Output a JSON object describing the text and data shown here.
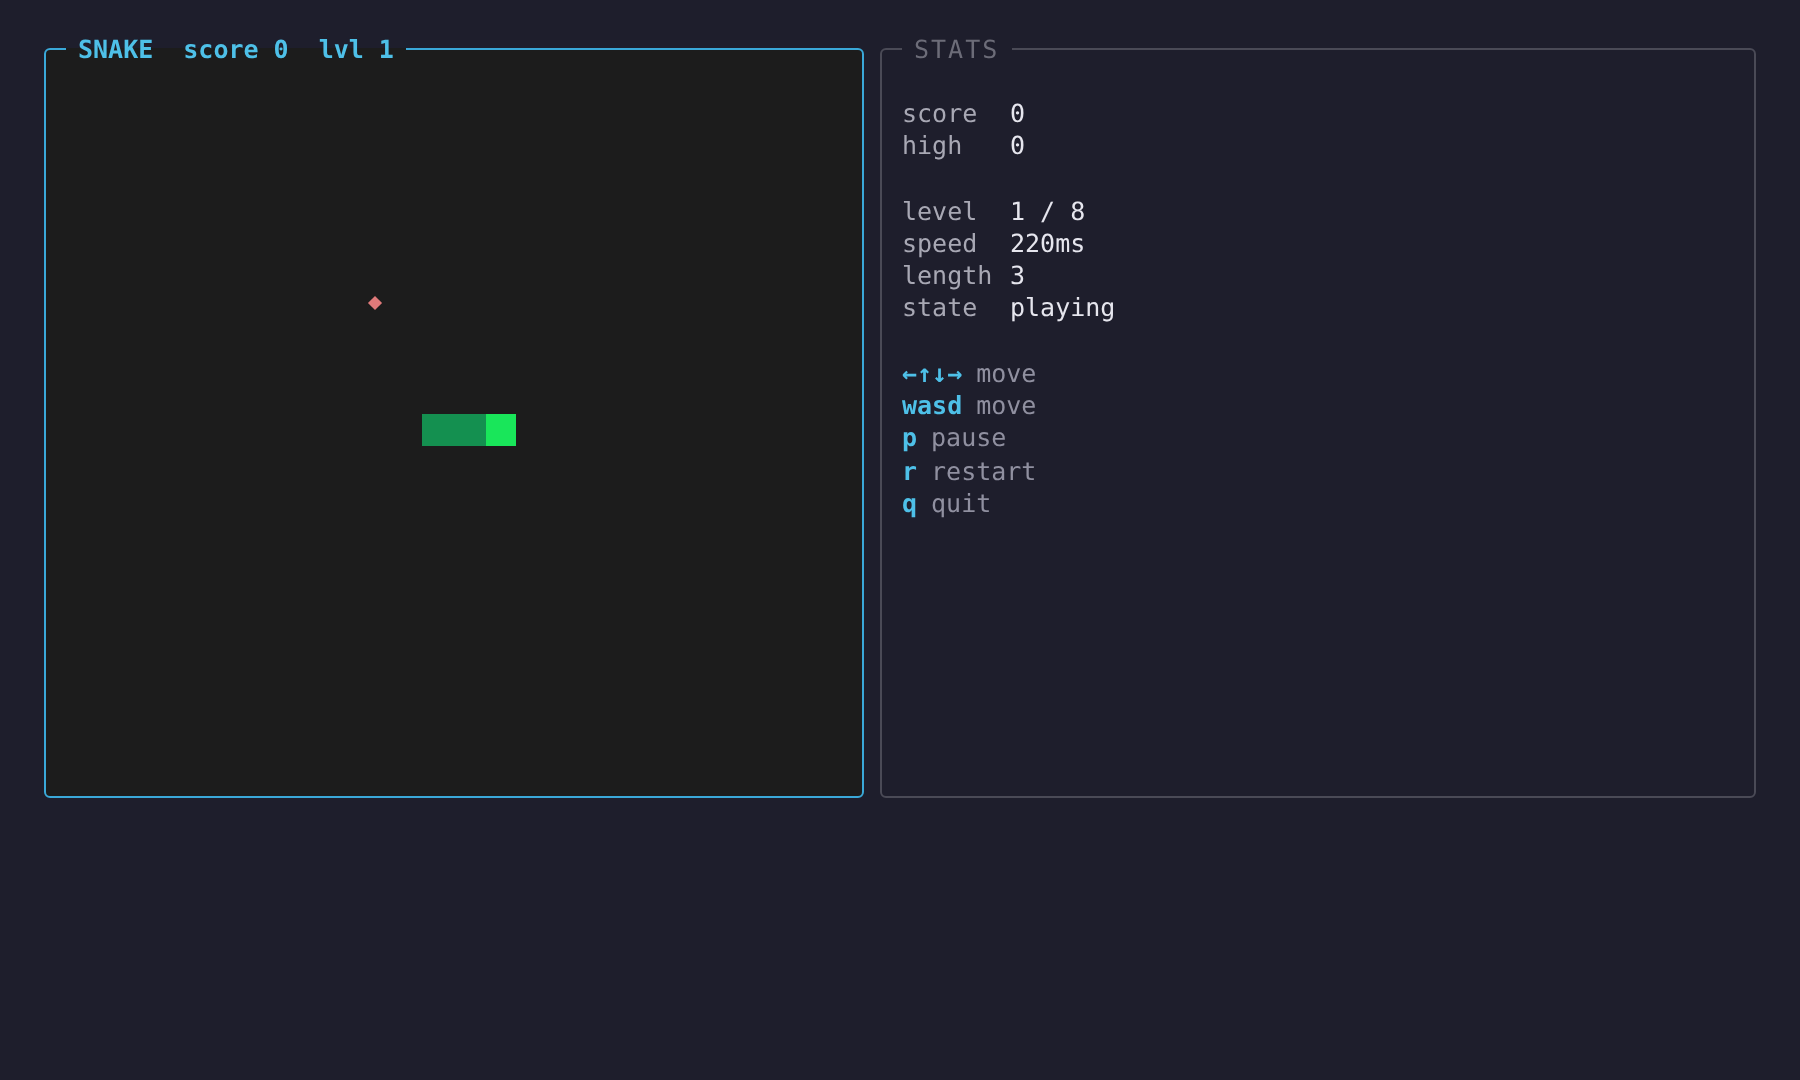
{
  "game": {
    "title": "SNAKE",
    "score_label": "score 0",
    "level_label": "lvl 1",
    "snake": [
      {
        "kind": "body"
      },
      {
        "kind": "body"
      },
      {
        "kind": "head"
      }
    ]
  },
  "stats": {
    "title": "STATS",
    "groups": [
      [
        {
          "label": "score",
          "value": "0"
        },
        {
          "label": "high",
          "value": "0"
        }
      ],
      [
        {
          "label": "level",
          "value": "1 / 8"
        },
        {
          "label": "speed",
          "value": "220ms"
        },
        {
          "label": "length",
          "value": "3"
        },
        {
          "label": "state",
          "value": "playing"
        }
      ]
    ],
    "keys": [
      {
        "key": "←↑↓→",
        "action": "move"
      },
      {
        "key": "wasd",
        "action": "move"
      },
      {
        "key": "p",
        "action": "pause"
      },
      {
        "key": "r",
        "action": "restart"
      },
      {
        "key": "q",
        "action": "quit"
      }
    ]
  }
}
